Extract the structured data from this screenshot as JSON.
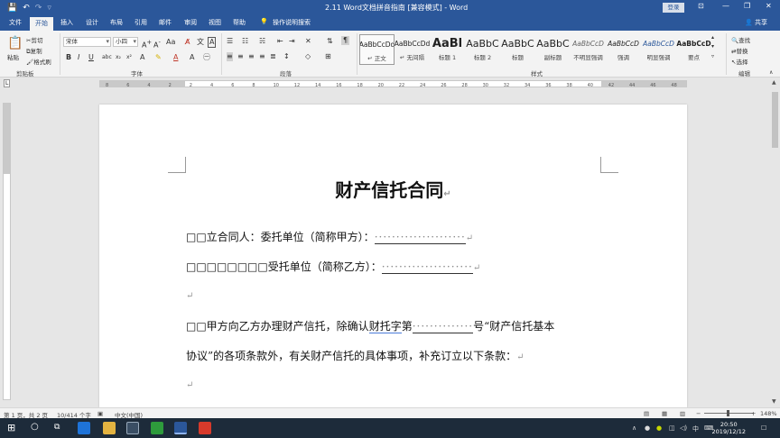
{
  "window": {
    "title": "2.11 Word文档拼音指南 [兼容模式] - Word",
    "login_label": "登录",
    "share_label": "共享"
  },
  "tabs": [
    {
      "label": "文件"
    },
    {
      "label": "开始"
    },
    {
      "label": "插入"
    },
    {
      "label": "设计"
    },
    {
      "label": "布局"
    },
    {
      "label": "引用"
    },
    {
      "label": "邮件"
    },
    {
      "label": "审阅"
    },
    {
      "label": "视图"
    },
    {
      "label": "帮助"
    },
    {
      "label": "操作说明搜索"
    }
  ],
  "ribbon": {
    "clipboard": {
      "paste_label": "粘贴",
      "cut_label": "剪切",
      "copy_label": "复制",
      "format_painter_label": "格式刷",
      "group_label": "剪贴板"
    },
    "font": {
      "font_name": "宋体",
      "font_size": "小四",
      "group_label": "字体"
    },
    "paragraph": {
      "group_label": "段落"
    },
    "styles": {
      "group_label": "样式",
      "items": [
        {
          "preview": "AaBbCcDd",
          "name": "正文"
        },
        {
          "preview": "AaBbCcDd",
          "name": "无间隔"
        },
        {
          "preview": "AaBl",
          "name": "标题 1"
        },
        {
          "preview": "AaBbC",
          "name": "标题 2"
        },
        {
          "preview": "AaBbC",
          "name": "标题"
        },
        {
          "preview": "AaBbC",
          "name": "副标题"
        },
        {
          "preview": "AaBbCcD",
          "name": "不明显强调"
        },
        {
          "preview": "AaBbCcD",
          "name": "强调"
        },
        {
          "preview": "AaBbCcD",
          "name": "明显强调"
        },
        {
          "preview": "AaBbCcD",
          "name": "要点"
        }
      ]
    },
    "editing": {
      "find_label": "查找",
      "replace_label": "替换",
      "select_label": "选择",
      "group_label": "编辑"
    }
  },
  "ruler": {
    "ticks": [
      "8",
      "6",
      "4",
      "2",
      "2",
      "4",
      "6",
      "8",
      "10",
      "12",
      "14",
      "16",
      "18",
      "20",
      "22",
      "24",
      "26",
      "28",
      "30",
      "32",
      "34",
      "36",
      "38",
      "40",
      "42",
      "44",
      "46",
      "48"
    ]
  },
  "document": {
    "title": "财产信托合同",
    "para_mark": "↵",
    "lines": {
      "l1_prefix": "□□立合同人：委托单位（简称甲方）：",
      "l2_prefix": "□□□□□□□□受托单位（简称乙方）：",
      "l4_a": "□□甲方向乙方办理财产信托，除确认",
      "l4_b": "财托字",
      "l4_c": "第",
      "l4_d": "号“财产信托基本",
      "l5": "协议”的各项条款外，有关财产信托的具体事项，补充订立以下条款：",
      "dots_long": "·····················",
      "dots_mid": "··············"
    }
  },
  "status": {
    "page": "第 1 页，共 2 页",
    "words": "10/414 个字",
    "language": "中文(中国)",
    "zoom": "148%"
  },
  "taskbar": {
    "time": "20:50",
    "date": "2019/12/12",
    "ime": "中"
  }
}
